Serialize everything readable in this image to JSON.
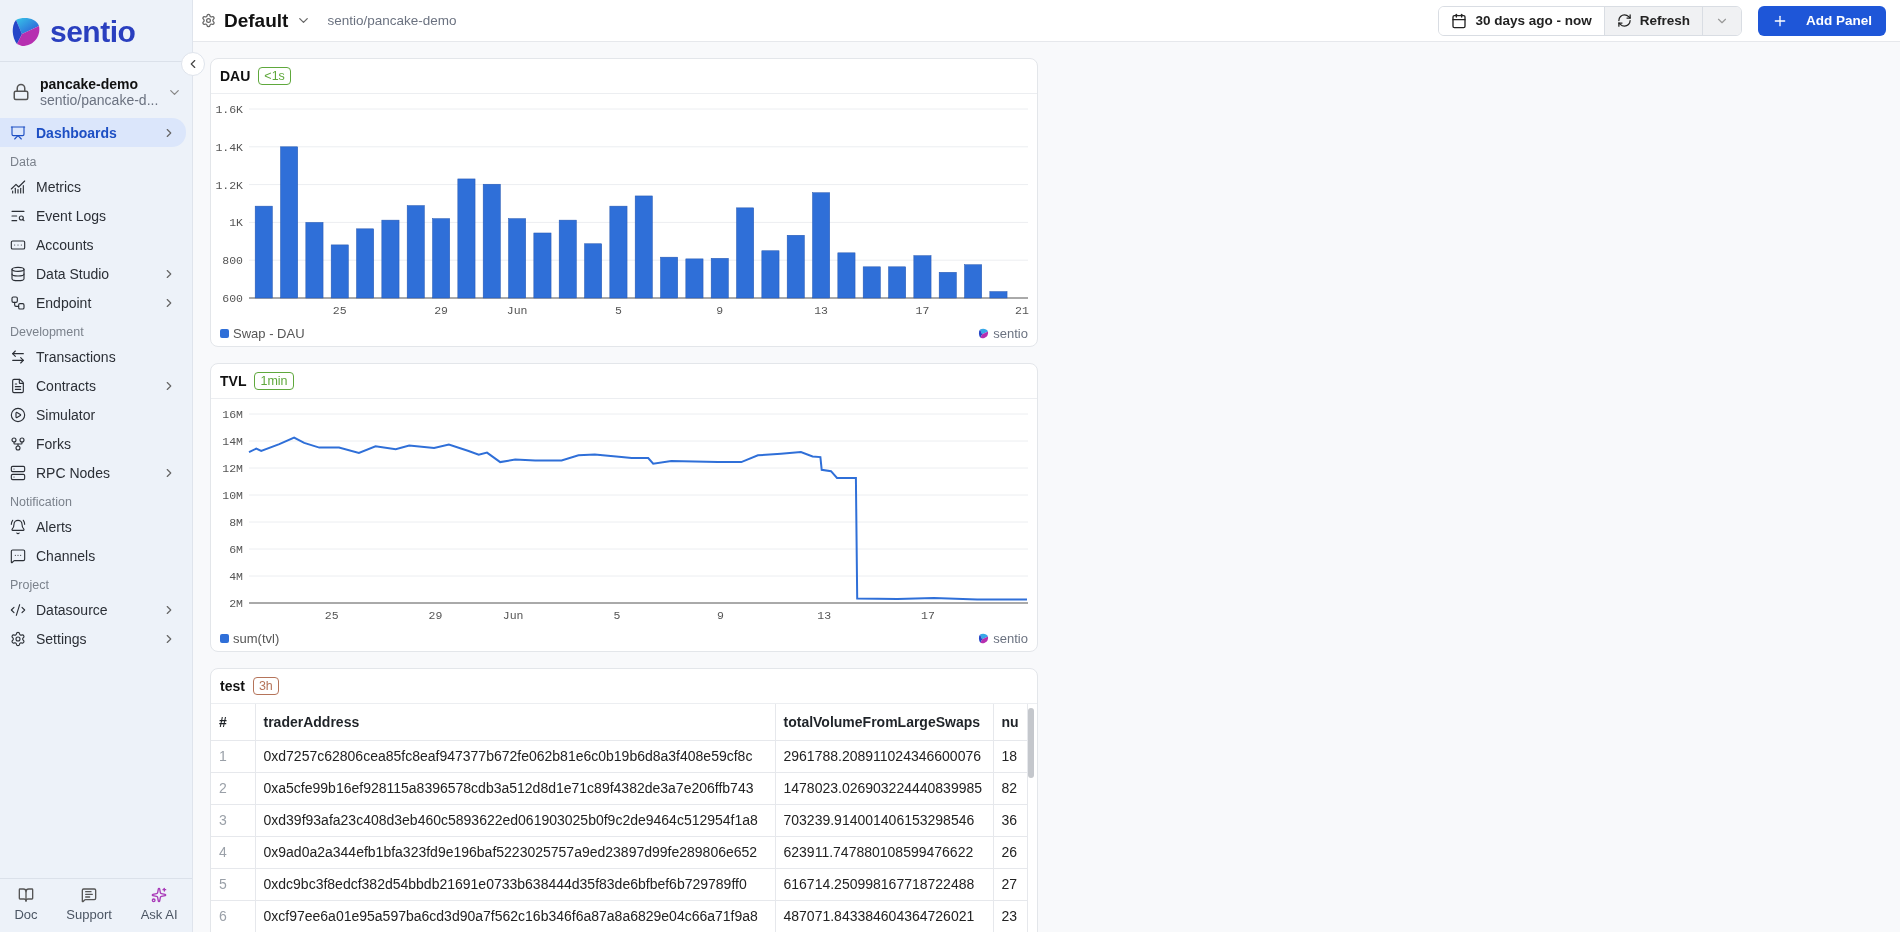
{
  "brand": {
    "name": "sentio"
  },
  "project": {
    "name": "pancake-demo",
    "path": "sentio/pancake-d..."
  },
  "nav": [
    {
      "kind": "item",
      "label": "Dashboards",
      "selected": true,
      "has_submenu": true
    },
    {
      "kind": "section",
      "label": "Data"
    },
    {
      "kind": "item",
      "label": "Metrics",
      "selected": false,
      "has_submenu": false
    },
    {
      "kind": "item",
      "label": "Event Logs",
      "selected": false,
      "has_submenu": false
    },
    {
      "kind": "item",
      "label": "Accounts",
      "selected": false,
      "has_submenu": false
    },
    {
      "kind": "item",
      "label": "Data Studio",
      "selected": false,
      "has_submenu": true
    },
    {
      "kind": "item",
      "label": "Endpoint",
      "selected": false,
      "has_submenu": true
    },
    {
      "kind": "section",
      "label": "Development"
    },
    {
      "kind": "item",
      "label": "Transactions",
      "selected": false,
      "has_submenu": false
    },
    {
      "kind": "item",
      "label": "Contracts",
      "selected": false,
      "has_submenu": true
    },
    {
      "kind": "item",
      "label": "Simulator",
      "selected": false,
      "has_submenu": false
    },
    {
      "kind": "item",
      "label": "Forks",
      "selected": false,
      "has_submenu": false
    },
    {
      "kind": "item",
      "label": "RPC Nodes",
      "selected": false,
      "has_submenu": true
    },
    {
      "kind": "section",
      "label": "Notification"
    },
    {
      "kind": "item",
      "label": "Alerts",
      "selected": false,
      "has_submenu": false
    },
    {
      "kind": "item",
      "label": "Channels",
      "selected": false,
      "has_submenu": false
    },
    {
      "kind": "section",
      "label": "Project"
    },
    {
      "kind": "item",
      "label": "Datasource",
      "selected": false,
      "has_submenu": true
    },
    {
      "kind": "item",
      "label": "Settings",
      "selected": false,
      "has_submenu": true
    }
  ],
  "footer": [
    {
      "label": "Doc"
    },
    {
      "label": "Support"
    },
    {
      "label": "Ask AI"
    }
  ],
  "header": {
    "title": "Default",
    "path": "sentio/pancake-demo",
    "time_range": "30 days ago - now",
    "refresh": "Refresh",
    "add_panel": "Add Panel"
  },
  "panels": [
    {
      "kind": "chart",
      "title": "DAU",
      "badge": {
        "text": "<1s",
        "color": "#5fa83c"
      },
      "brand_mark": "sentio",
      "chart_data": {
        "type": "bar",
        "grid": true,
        "x": [
          "--05-22",
          "--05-23",
          "--05-24",
          "--05-25",
          "--05-26",
          "--05-27",
          "--05-28",
          "--05-29",
          "--05-30",
          "--05-31",
          "--06-01",
          "--06-02",
          "--06-03",
          "--06-04",
          "--06-05",
          "--06-06",
          "--06-07",
          "--06-08",
          "--06-09",
          "--06-10",
          "--06-11",
          "--06-12",
          "--06-13",
          "--06-14",
          "--06-15",
          "--06-16",
          "--06-17",
          "--06-18",
          "--06-19",
          "--06-20"
        ],
        "xlim": [
          "--05-21T10:00",
          "--06-21T04:00"
        ],
        "series": [
          {
            "name": "Swap - DAU",
            "color": "#2f6fd8",
            "values": [
              1086,
              1400,
              1000,
              881,
              966,
              1012,
              1089,
              1020,
              1230,
              1202,
              1020,
              944,
              1012,
              887,
              1086,
              1140,
              816,
              807,
              810,
              1077,
              850,
              932,
              1157,
              839,
              765,
              765,
              824,
              736,
              776,
              634
            ]
          }
        ],
        "ylim": [
          600,
          1600
        ],
        "xticks": [
          {
            "value": "--05-25",
            "label": "25"
          },
          {
            "value": "--05-29",
            "label": "29"
          },
          {
            "value": "--06-01",
            "label": "Jun"
          },
          {
            "value": "--06-05",
            "label": "5"
          },
          {
            "value": "--06-09",
            "label": "9"
          },
          {
            "value": "--06-13",
            "label": "13"
          },
          {
            "value": "--06-17",
            "label": "17"
          },
          {
            "value": "--06-21",
            "label": "21"
          }
        ],
        "yticks": [
          {
            "value": 600,
            "label": "600"
          },
          {
            "value": 800,
            "label": "800"
          },
          {
            "value": 1000,
            "label": "1K"
          },
          {
            "value": 1200,
            "label": "1.2K"
          },
          {
            "value": 1400,
            "label": "1.4K"
          },
          {
            "value": 1600,
            "label": "1.6K"
          }
        ]
      }
    },
    {
      "kind": "chart",
      "title": "TVL",
      "badge": {
        "text": "1min",
        "color": "#5fa83c"
      },
      "brand_mark": "sentio",
      "chart_data": {
        "type": "line",
        "grid": true,
        "x": [
          "--05-21T19:26",
          "--05-22T02:10",
          "--05-22T06:43",
          "--05-22T23:31",
          "--05-23T13:12",
          "--05-23T22:34",
          "--05-24T12:29",
          "--05-25T06:43",
          "--05-26T01:12",
          "--05-26T16:34",
          "--05-27T11:17",
          "--05-27T23:46",
          "--05-28T22:48",
          "--05-29T12:29",
          "--05-30T06:43",
          "--05-30T16:05",
          "--05-30T23:46",
          "--05-31T12:00",
          "--06-01T01:55",
          "--06-01T20:24",
          "--06-02T20:53",
          "--06-03T12:29",
          "--06-04T03:36",
          "--06-05T04:19",
          "--06-05T13:41",
          "--06-06T05:02",
          "--06-06T09:36",
          "--06-07T02:24",
          "--06-08T21:36",
          "--06-09T19:12",
          "--06-10T10:34",
          "--06-11T07:55",
          "--06-12T02:24",
          "--06-12T13:12",
          "--06-12T20:24",
          "--06-12T21:36",
          "--06-13T06:14",
          "--06-13T11:46",
          "--06-14T05:17",
          "--06-14T06:29",
          "--06-15T19:41",
          "--06-17T05:31",
          "--06-18T21:36",
          "--06-20T19:41"
        ],
        "series": [
          {
            "name": "sum(tvl)",
            "color": "#2f6fd8",
            "values": [
              13180000,
              13440000,
              13260000,
              13760000,
              14260000,
              13860000,
              13510000,
              13510000,
              13110000,
              13610000,
              13390000,
              13660000,
              13480000,
              13740000,
              13260000,
              12990000,
              13140000,
              12440000,
              12620000,
              12560000,
              12560000,
              12940000,
              13010000,
              12810000,
              12740000,
              12740000,
              12320000,
              12510000,
              12440000,
              12440000,
              12940000,
              13060000,
              13180000,
              12860000,
              12810000,
              11870000,
              11760000,
              11270000,
              11270000,
              2330000,
              2290000,
              2380000,
              2260000,
              2260000
            ]
          }
        ],
        "xlim": [
          "--05-21T19:26",
          "--06-20T20:38"
        ],
        "ylim": [
          2000000,
          16000000
        ],
        "xticks": [
          {
            "value": "--05-25",
            "label": "25"
          },
          {
            "value": "--05-29",
            "label": "29"
          },
          {
            "value": "--06-01",
            "label": "Jun"
          },
          {
            "value": "--06-05",
            "label": "5"
          },
          {
            "value": "--06-09",
            "label": "9"
          },
          {
            "value": "--06-13",
            "label": "13"
          },
          {
            "value": "--06-17",
            "label": "17"
          }
        ],
        "yticks": [
          {
            "value": 2000000,
            "label": "2M"
          },
          {
            "value": 4000000,
            "label": "4M"
          },
          {
            "value": 6000000,
            "label": "6M"
          },
          {
            "value": 8000000,
            "label": "8M"
          },
          {
            "value": 10000000,
            "label": "10M"
          },
          {
            "value": 12000000,
            "label": "12M"
          },
          {
            "value": 14000000,
            "label": "14M"
          },
          {
            "value": 16000000,
            "label": "16M"
          }
        ]
      }
    },
    {
      "kind": "table",
      "title": "test",
      "badge": {
        "text": "3h",
        "color": "#b5745a"
      },
      "columns": [
        "#",
        "traderAddress",
        "totalVolumeFromLargeSwaps",
        "nu"
      ],
      "rows": [
        [
          "1",
          "0xd7257c62806cea85fc8eaf947377b672fe062b81e6c0b19b6d8a3f408e59cf8c",
          "2961788.208911024346600076",
          "18"
        ],
        [
          "2",
          "0xa5cfe99b16ef928115a8396578cdb3a512d8d1e71c89f4382de3a7e206ffb743",
          "1478023.026903224440839985",
          "82"
        ],
        [
          "3",
          "0xd39f93afa23c408d3eb460c5893622ed061903025b0f9c2de9464c512954f1a8",
          "703239.914001406153298546",
          "36"
        ],
        [
          "4",
          "0x9ad0a2a344efb1bfa323fd9e196baf5223025757a9ed23897d99fe289806e652",
          "623911.747880108599476622",
          "26"
        ],
        [
          "5",
          "0xdc9bc3f8edcf382d54bbdb21691e0733b638444d35f83de6bfbef6b729789ff0",
          "616714.250998167718722488",
          "27"
        ],
        [
          "6",
          "0xcf97ee6a01e95a597ba6cd3d90a7f562c16b346f6a87a8a6829e04c66a71f9a8",
          "487071.843384604364726021",
          "23"
        ]
      ]
    }
  ]
}
